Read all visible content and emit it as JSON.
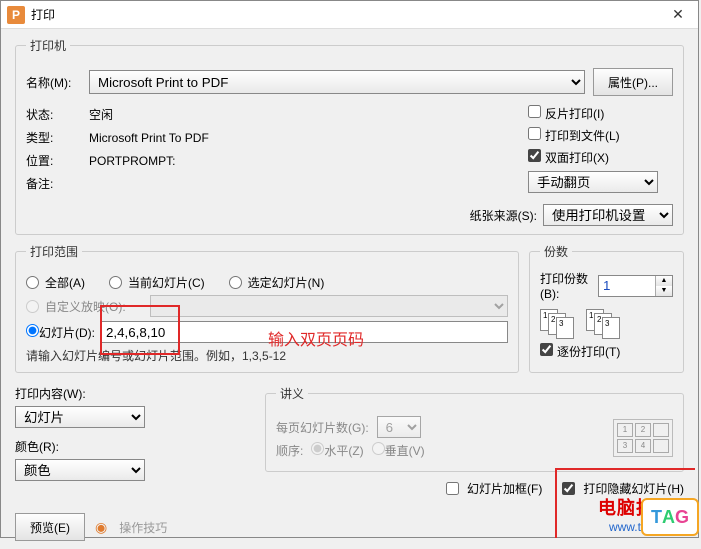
{
  "titlebar": {
    "app_letter": "P",
    "title": "打印"
  },
  "printer": {
    "legend": "打印机",
    "name_label": "名称(M):",
    "name_value": "Microsoft Print to PDF",
    "properties_btn": "属性(P)...",
    "status_label": "状态:",
    "status_value": "空闲",
    "type_label": "类型:",
    "type_value": "Microsoft Print To PDF",
    "where_label": "位置:",
    "where_value": "PORTPROMPT:",
    "comment_label": "备注:",
    "reverse_label": "反片打印(I)",
    "to_file_label": "打印到文件(L)",
    "duplex_label": "双面打印(X)",
    "flip_value": "手动翻页",
    "paper_label": "纸张来源(S):",
    "paper_value": "使用打印机设置"
  },
  "range": {
    "legend": "打印范围",
    "all_label": "全部(A)",
    "current_label": "当前幻灯片(C)",
    "selected_label": "选定幻灯片(N)",
    "custom_label": "自定义放映(O):",
    "slides_label": "幻灯片(D):",
    "slides_value": "2,4,6,8,10",
    "hint": "请输入幻灯片编号或幻灯片范围。例如，1,3,5-12"
  },
  "copies": {
    "legend": "份数",
    "count_label": "打印份数(B):",
    "count_value": "1",
    "collate_label": "逐份打印(T)"
  },
  "print_what": {
    "label": "打印内容(W):",
    "value": "幻灯片"
  },
  "color": {
    "label": "颜色(R):",
    "value": "颜色"
  },
  "handout": {
    "legend": "讲义",
    "per_page_label": "每页幻灯片数(G):",
    "per_page_value": "6",
    "order_label": "顺序:",
    "horiz_label": "水平(Z)",
    "vert_label": "垂直(V)"
  },
  "frame": {
    "frame_label": "幻灯片加框(F)",
    "hidden_label": "打印隐藏幻灯片(H)"
  },
  "footer": {
    "preview_btn": "预览(E)",
    "tips_label": "操作技巧"
  },
  "annotation": {
    "text": "输入双页页码"
  },
  "watermark": {
    "line1": "电脑技术网",
    "line2": "www.tagxp.com",
    "logo": "TAG"
  }
}
